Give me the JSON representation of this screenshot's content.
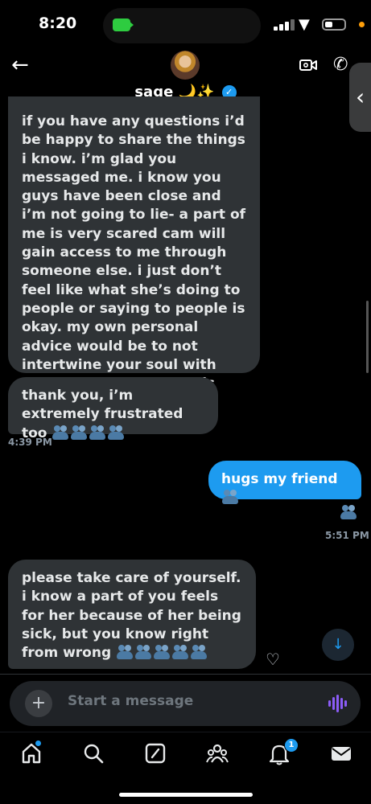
{
  "status_bar": {
    "time": "8:20"
  },
  "header": {
    "back_icon": "arrow-left-icon",
    "contact_name": "sage 🌙✨",
    "verified_icon": "verified-badge-icon",
    "video_icon": "video-call-icon",
    "phone_icon": "phone-icon"
  },
  "messages": [
    {
      "direction": "received",
      "text": "if you have any questions i’d be happy to share the things i know. i’m glad you messaged me. i know you guys have been close and i’m not going to lie- a part of me is very scared cam will gain access to me through someone else. i just don’t feel like what she’s doing to people or saying to people is okay. my own personal advice would be to not intertwine your soul with someone like that, she is very unhealed at the moment..."
    },
    {
      "direction": "received",
      "text": "thank you, i’m extremely frustrated too",
      "emoji_count": 4,
      "emoji_name": "people-hugging-emoji",
      "time": "4:39 PM"
    },
    {
      "direction": "sent",
      "text": "hugs my friend",
      "emoji_count": 1,
      "emoji_name": "people-hugging-emoji",
      "reply_emoji_count": 1,
      "time": "5:51 PM"
    },
    {
      "direction": "received",
      "text": "please take care of yourself. i know a part of you feels for her because of her being sick, but you know right from wrong",
      "emoji_count": 5,
      "emoji_name": "people-hugging-emoji"
    }
  ],
  "composer": {
    "placeholder": "Start a message",
    "add_icon": "plus-icon",
    "voice_icon": "voice-waveform-icon"
  },
  "tab_bar": {
    "items": [
      "home-icon",
      "search-icon",
      "grok-icon",
      "communities-icon",
      "notifications-icon",
      "messages-icon"
    ],
    "notification_count": "1"
  },
  "colors": {
    "accent": "#1d9bf0",
    "received_bubble": "#2f3336",
    "background": "#000000"
  }
}
